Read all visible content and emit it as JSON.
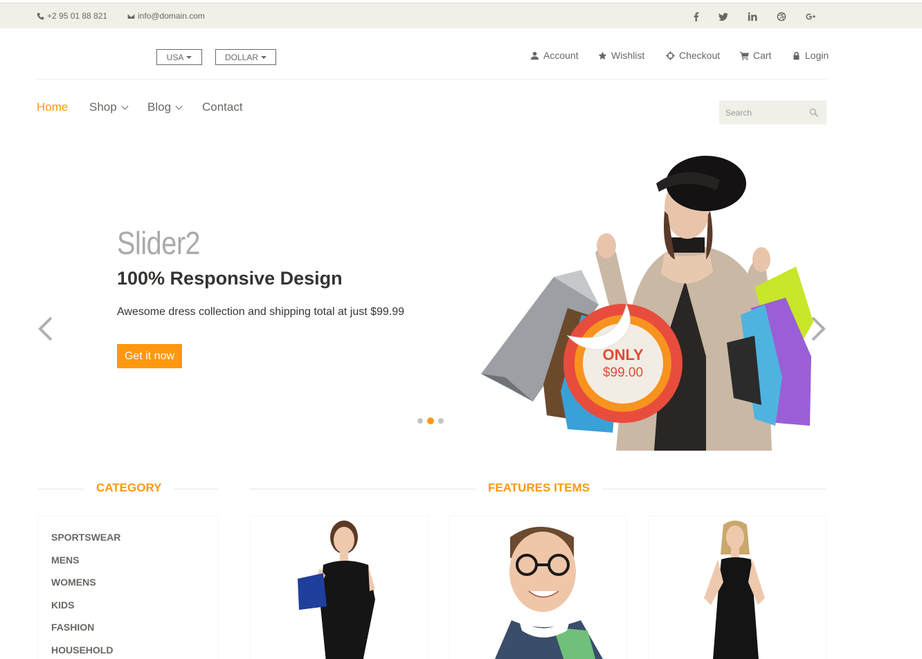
{
  "topbar": {
    "phone": "+2 95 01 88 821",
    "email": "info@domain.com",
    "social": [
      "facebook-icon",
      "twitter-icon",
      "linkedin-icon",
      "dribbble-icon",
      "google-plus-icon"
    ]
  },
  "header": {
    "country": "USA",
    "currency": "DOLLAR",
    "usernav": {
      "account": "Account",
      "wishlist": "Wishlist",
      "checkout": "Checkout",
      "cart": "Cart",
      "login": "Login"
    }
  },
  "nav": {
    "home": "Home",
    "shop": "Shop",
    "blog": "Blog",
    "contact": "Contact",
    "search_placeholder": "Search"
  },
  "slider": {
    "title": "Slider2",
    "subtitle": "100% Responsive Design",
    "text": "Awesome dress collection and shipping total at just $99.99",
    "button": "Get it now",
    "badge_top": "ONLY",
    "badge_price": "$99.00",
    "active_dot": 1,
    "dot_count": 3
  },
  "sections": {
    "category": "CATEGORY",
    "features": "FEATURES ITEMS"
  },
  "categories": [
    "SPORTSWEAR",
    "MENS",
    "WOMENS",
    "KIDS",
    "FASHION",
    "HOUSEHOLD"
  ],
  "colors": {
    "accent": "#fe980f",
    "topbar_bg": "#f0f0e9",
    "text": "#696763",
    "badge_red": "#e04b3a"
  }
}
